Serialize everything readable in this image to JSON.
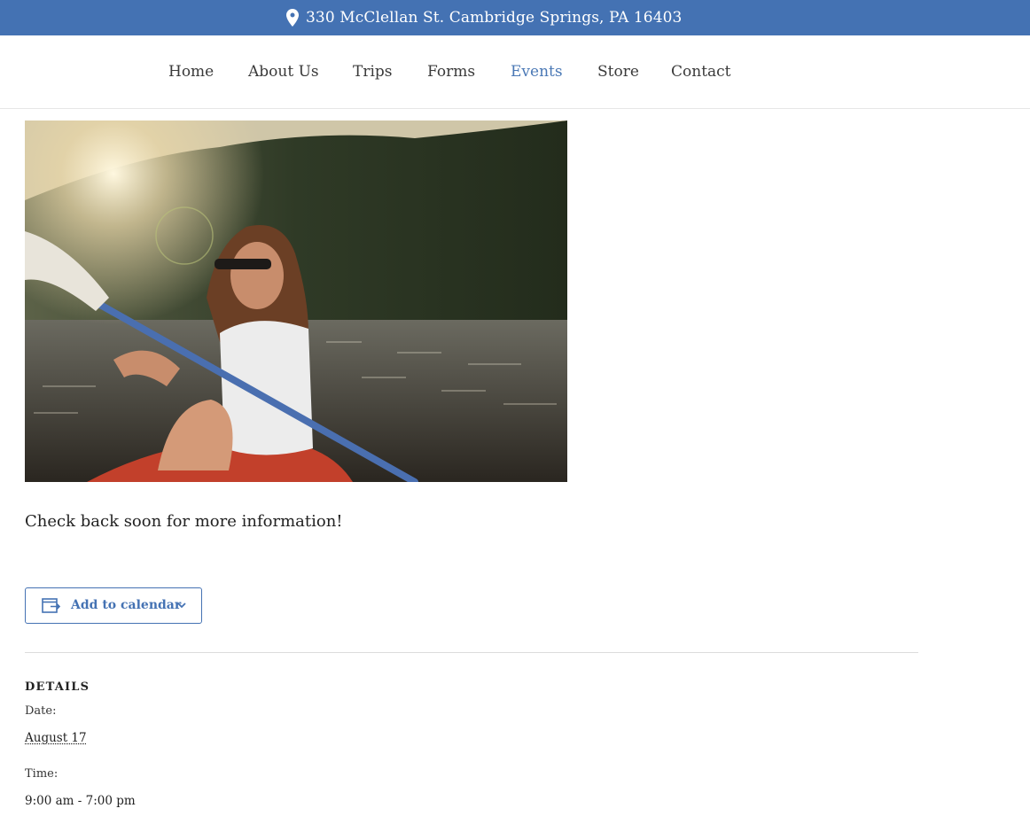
{
  "topbar": {
    "address": "330 McClellan St. Cambridge Springs, PA 16403",
    "icon": "map-pin-icon",
    "color": "#4472b3"
  },
  "nav": {
    "items": [
      {
        "label": "Home"
      },
      {
        "label": "About Us"
      },
      {
        "label": "Trips"
      },
      {
        "label": "Forms"
      },
      {
        "label": "Events",
        "active": true
      },
      {
        "label": "Store"
      },
      {
        "label": "Contact"
      }
    ],
    "active_color": "#4a78b5"
  },
  "event": {
    "description": "Check back soon for more information!",
    "add_to_calendar_label": "Add to calendar"
  },
  "details": {
    "title": "DETAILS",
    "date_label": "Date:",
    "date_value": "August 17",
    "time_label": "Time:",
    "time_value": "9:00 am - 7:00 pm"
  }
}
